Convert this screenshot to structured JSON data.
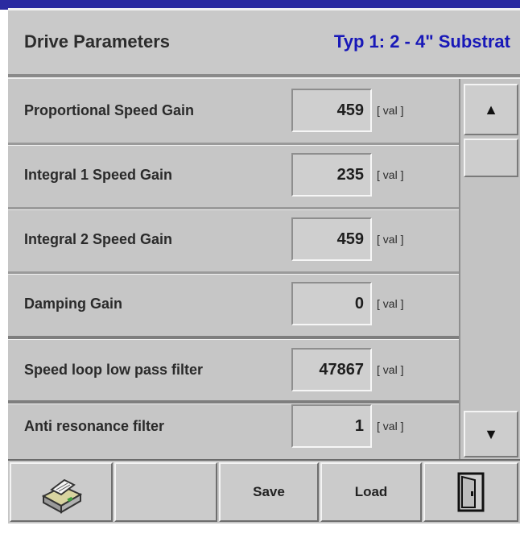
{
  "header": {
    "title": "Drive Parameters",
    "type_label": "Typ 1: 2 - 4\" Substrat"
  },
  "parameters": [
    {
      "label": "Proportional Speed Gain",
      "value": "459",
      "unit": "[ val ]"
    },
    {
      "label": "Integral 1 Speed Gain",
      "value": "235",
      "unit": "[ val ]"
    },
    {
      "label": "Integral 2 Speed Gain",
      "value": "459",
      "unit": "[ val ]"
    },
    {
      "label": "Damping Gain",
      "value": "0",
      "unit": "[ val ]"
    },
    {
      "label": "Speed loop low pass filter",
      "value": "47867",
      "unit": "[ val ]"
    },
    {
      "label": "Anti resonance filter",
      "value": "1",
      "unit": "[ val ]"
    }
  ],
  "scrollbar": {
    "up_icon": "triangle-up",
    "up_glyph": "▲",
    "down_icon": "triangle-down",
    "down_glyph": "▼"
  },
  "toolbar": {
    "print_icon": "printer-icon",
    "save_label": "Save",
    "load_label": "Load",
    "exit_icon": "door-icon"
  },
  "colors": {
    "accent_text": "#1818b8",
    "panel_bg": "#c6c6c6",
    "top_line": "#2a2aa0"
  }
}
